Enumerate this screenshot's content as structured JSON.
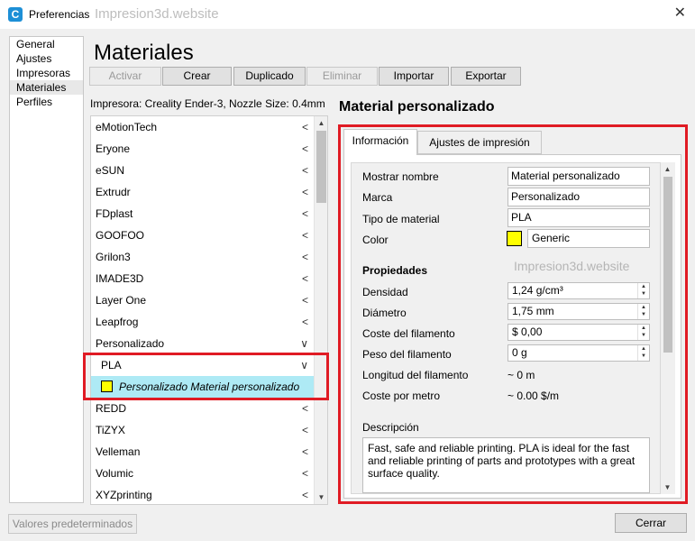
{
  "window": {
    "title": "Preferencias",
    "watermark": "Impresion3d.website",
    "close_glyph": "✕"
  },
  "nav": {
    "items": [
      "General",
      "Ajustes",
      "Impresoras",
      "Materiales",
      "Perfiles"
    ],
    "selected": "Materiales"
  },
  "page_title": "Materiales",
  "toolbar": {
    "activar": "Activar",
    "crear": "Crear",
    "duplicado": "Duplicado",
    "eliminar": "Eliminar",
    "importar": "Importar",
    "exportar": "Exportar"
  },
  "printer_label": "Impresora: Creality Ender-3, Nozzle Size: 0.4mm",
  "materials": [
    {
      "name": "eMotionTech",
      "chevron": "<"
    },
    {
      "name": "Eryone",
      "chevron": "<"
    },
    {
      "name": "eSUN",
      "chevron": "<"
    },
    {
      "name": "Extrudr",
      "chevron": "<"
    },
    {
      "name": "FDplast",
      "chevron": "<"
    },
    {
      "name": "GOOFOO",
      "chevron": "<"
    },
    {
      "name": "Grilon3",
      "chevron": "<"
    },
    {
      "name": "IMADE3D",
      "chevron": "<"
    },
    {
      "name": "Layer One",
      "chevron": "<"
    },
    {
      "name": "Leapfrog",
      "chevron": "<"
    },
    {
      "name": "Personalizado",
      "chevron": "∨"
    },
    {
      "name": "PLA",
      "chevron": "∨"
    },
    {
      "name": "Personalizado Material personalizado",
      "chevron": ""
    },
    {
      "name": "REDD",
      "chevron": "<"
    },
    {
      "name": "TiZYX",
      "chevron": "<"
    },
    {
      "name": "Velleman",
      "chevron": "<"
    },
    {
      "name": "Volumic",
      "chevron": "<"
    },
    {
      "name": "XYZprinting",
      "chevron": "<"
    }
  ],
  "detail": {
    "title": "Material personalizado",
    "tabs": [
      "Información",
      "Ajustes de impresión"
    ],
    "fields": {
      "display_name_label": "Mostrar nombre",
      "display_name": "Material personalizado",
      "brand_label": "Marca",
      "brand": "Personalizado",
      "type_label": "Tipo de material",
      "type": "PLA",
      "color_label": "Color",
      "color_name": "Generic",
      "color_hex": "#ffff00"
    },
    "properties_heading": "Propiedades",
    "properties": {
      "density_label": "Densidad",
      "density": "1,24 g/cm³",
      "diameter_label": "Diámetro",
      "diameter": "1,75 mm",
      "cost_label": "Coste del filamento",
      "cost": "$ 0,00",
      "weight_label": "Peso del filamento",
      "weight": "0 g",
      "length_label": "Longitud del filamento",
      "length": "~ 0 m",
      "cost_per_meter_label": "Coste por metro",
      "cost_per_meter": "~ 0.00 $/m"
    },
    "description_label": "Descripción",
    "description": "Fast, safe and reliable printing. PLA is ideal for the fast and reliable printing of parts and prototypes with a great surface quality."
  },
  "buttons": {
    "reset": "Valores predeterminados",
    "close": "Cerrar"
  },
  "colors": {
    "highlight": "#aeeaf5",
    "annotation_red": "#e01b24",
    "brand_blue": "#1d8fd6"
  }
}
